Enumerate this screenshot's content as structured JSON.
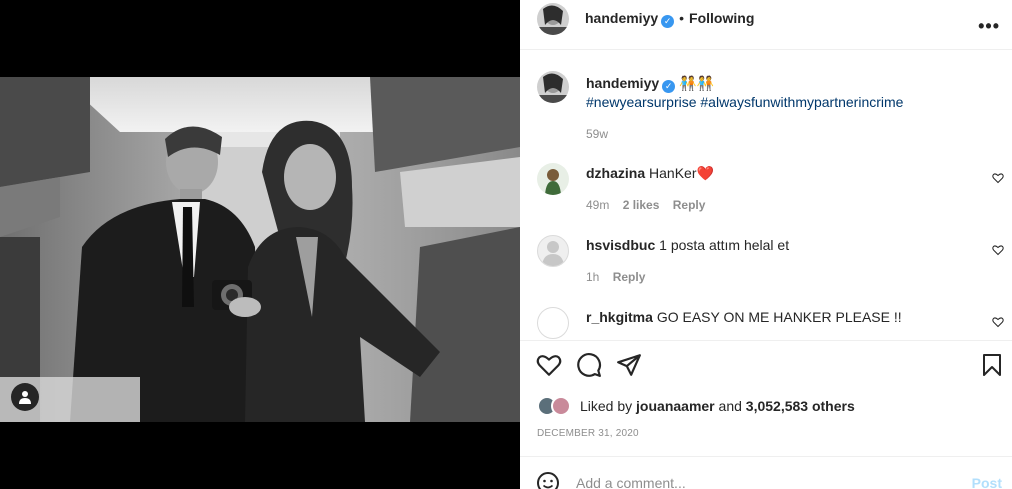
{
  "post": {
    "author": "handemiyy",
    "follow_status": "Following",
    "separator": "•",
    "more_glyph": "•••",
    "caption_emoji": "🧑‍🤝‍🧑🧑‍🤝‍🧑",
    "hashtags": "#newyearsurprise #alwaysfunwithmypartnerincrime",
    "caption_age": "59w"
  },
  "comments": [
    {
      "user": "dzhazina",
      "text": "HanKer",
      "emoji": "❤️",
      "age": "49m",
      "likes": "2 likes",
      "reply": "Reply"
    },
    {
      "user": "hsvisdbuc",
      "text": "1 posta attım helal et",
      "age": "1h",
      "reply": "Reply"
    },
    {
      "user": "r_hkgitma",
      "text": "GO EASY ON ME HANKER PLEASE !!"
    }
  ],
  "likes": {
    "prefix": "Liked by",
    "user": "jouanaamer",
    "middle": "and",
    "count": "3,052,583 others"
  },
  "date": "DECEMBER 31, 2020",
  "add_comment": {
    "placeholder": "Add a comment...",
    "post_label": "Post"
  },
  "icons": [
    "user-tag-icon",
    "verified-icon",
    "more-icon",
    "heart-icon",
    "comment-icon",
    "share-icon",
    "save-icon",
    "emoji-icon"
  ],
  "colors": {
    "hashtag": "#00376b",
    "verified": "#3897f0",
    "heart_red": "#ed4956",
    "post_disabled": "#b2dffc"
  }
}
